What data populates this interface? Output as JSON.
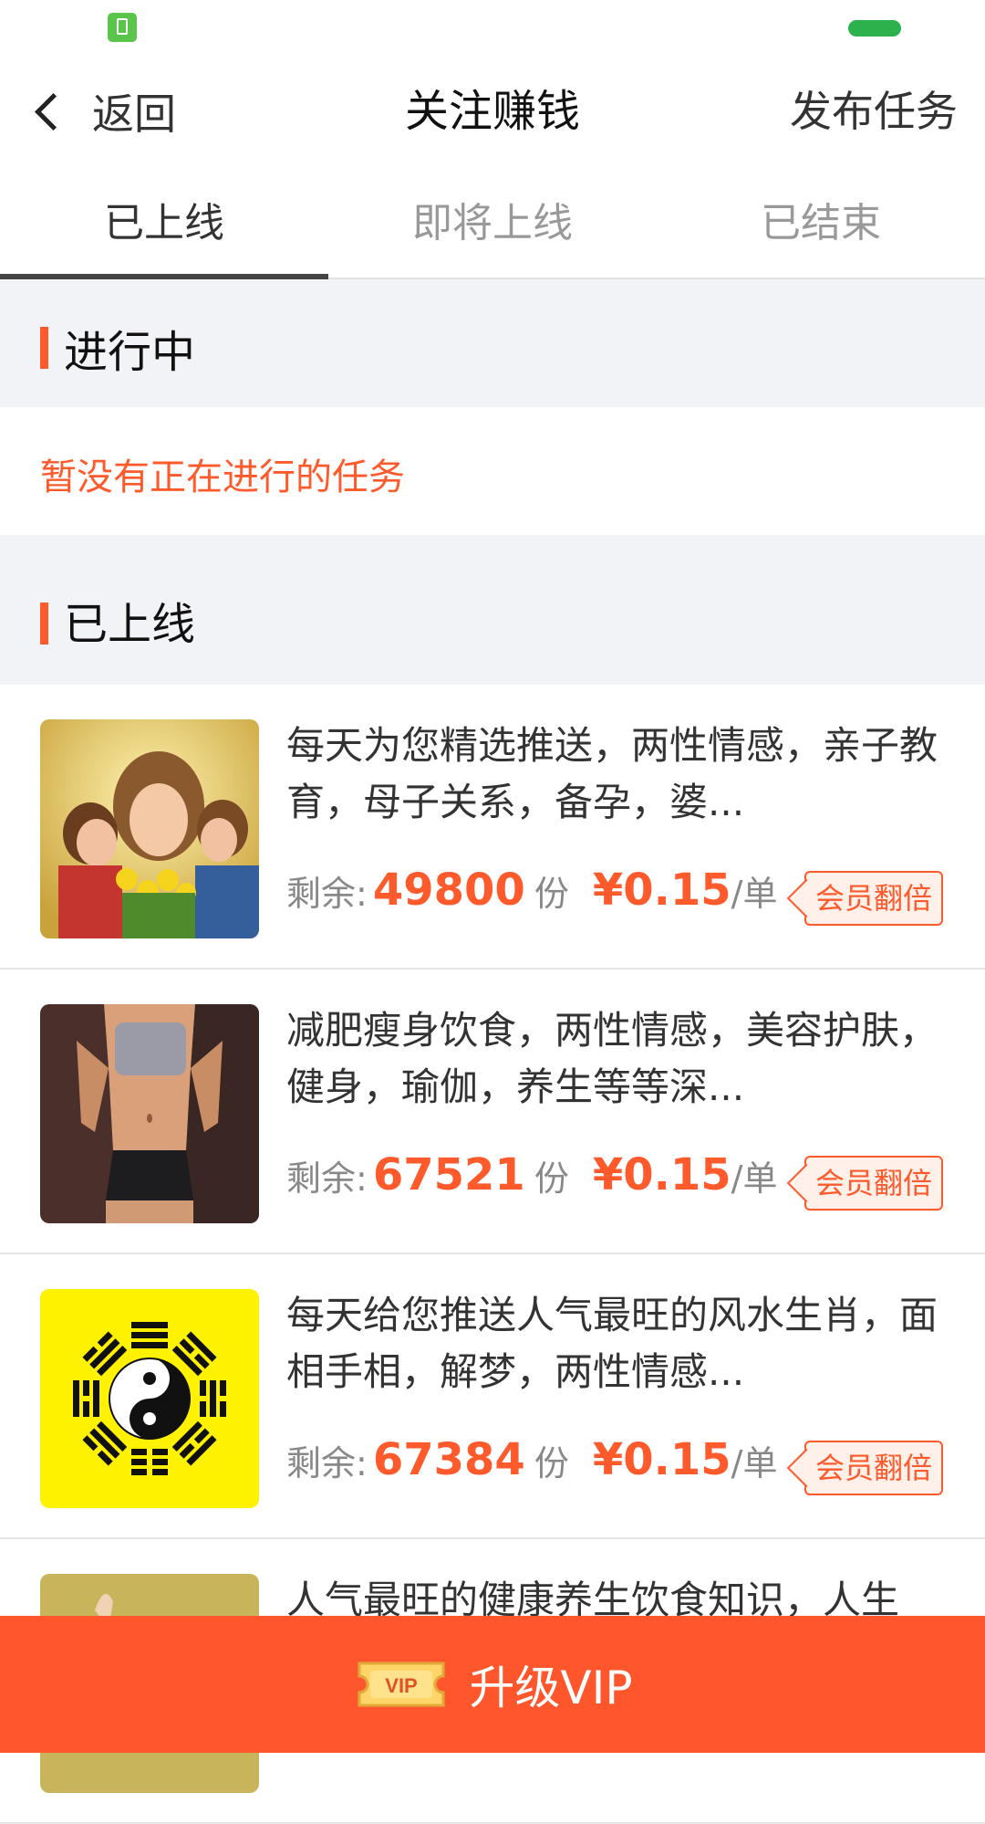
{
  "header": {
    "back_label": "返回",
    "title": "关注赚钱",
    "publish_label": "发布任务"
  },
  "tabs": [
    {
      "label": "已上线",
      "active": true
    },
    {
      "label": "即将上线",
      "active": false
    },
    {
      "label": "已结束",
      "active": false
    }
  ],
  "sections": {
    "ongoing": {
      "title": "进行中",
      "empty_text": "暂没有正在进行的任务"
    },
    "online": {
      "title": "已上线"
    }
  },
  "tasks": [
    {
      "description": "每天为您精选推送，两性情感，亲子教育，母子关系，备孕，婆...",
      "remaining_label": "剩余:",
      "remaining": "49800",
      "unit": "份",
      "price": "¥0.15",
      "per": "/单",
      "badge": "会员翻倍",
      "thumb": "mother-children-icon"
    },
    {
      "description": "减肥瘦身饮食，两性情感，美容护肤，健身，瑜伽，养生等等深...",
      "remaining_label": "剩余:",
      "remaining": "67521",
      "unit": "份",
      "price": "¥0.15",
      "per": "/单",
      "badge": "会员翻倍",
      "thumb": "fitness-body-icon"
    },
    {
      "description": "每天给您推送人气最旺的风水生肖，面相手相，解梦，两性情感...",
      "remaining_label": "剩余:",
      "remaining": "67384",
      "unit": "份",
      "price": "¥0.15",
      "per": "/单",
      "badge": "会员翻倍",
      "thumb": "yin-yang-bagua-icon"
    },
    {
      "description": "人气最旺的健康养生饮食知识，人生",
      "thumb": "health-icon"
    }
  ],
  "vip_bar": {
    "ticket_text": "VIP",
    "label": "升级VIP"
  },
  "colors": {
    "accent": "#ff5a2c",
    "vip_bar": "#ff562b",
    "section_bg": "#f2f3f7"
  }
}
